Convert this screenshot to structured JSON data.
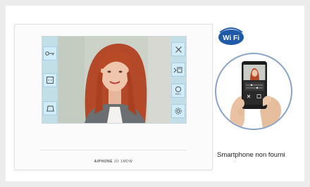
{
  "monitor": {
    "brand_bold": "AIPHONE",
    "brand_model": "JO 1MDW",
    "left_buttons": [
      {
        "name": "key-icon"
      },
      {
        "name": "door-release-icon"
      },
      {
        "name": "light-icon"
      }
    ],
    "right_buttons": [
      {
        "name": "close-icon"
      },
      {
        "name": "transfer-icon"
      },
      {
        "name": "record-icon",
        "label": "REC"
      },
      {
        "name": "settings-icon"
      }
    ]
  },
  "wifi": {
    "label": "Wi Fi"
  },
  "phone": {
    "screen_buttons": [
      "close-icon",
      "transfer-icon"
    ]
  },
  "caption": "Smartphone non fourni",
  "colors": {
    "wifi_blue": "#1e5aa8",
    "accent": "#8aa4c8"
  }
}
